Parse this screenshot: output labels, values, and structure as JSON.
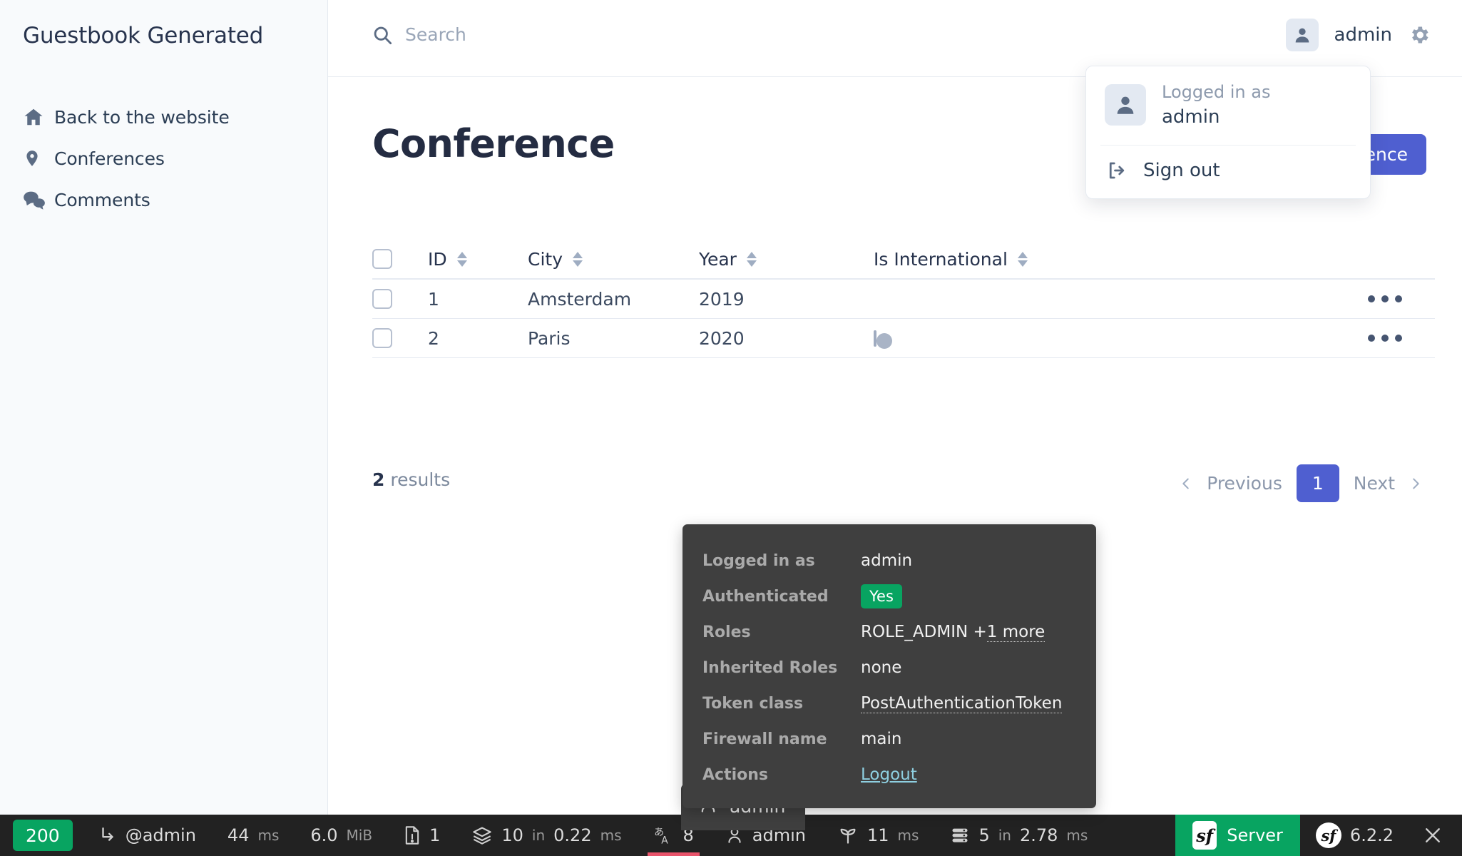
{
  "sidebar": {
    "brand": "Guestbook Generated",
    "items": [
      {
        "label": "Back to the website",
        "icon": "home-icon"
      },
      {
        "label": "Conferences",
        "icon": "map-pin-icon"
      },
      {
        "label": "Comments",
        "icon": "comments-icon"
      }
    ]
  },
  "header": {
    "search_placeholder": "Search",
    "search_value": "",
    "username": "admin",
    "gear_icon": "gear-icon"
  },
  "user_menu": {
    "logged_in_as_label": "Logged in as",
    "username": "admin",
    "sign_out_label": "Sign out"
  },
  "main": {
    "title": "Conference",
    "add_button_label": "Add Conference",
    "accent_color": "#4f5fd0"
  },
  "table": {
    "columns": [
      "ID",
      "City",
      "Year",
      "Is International"
    ],
    "rows": [
      {
        "id": "1",
        "city": "Amsterdam",
        "year": "2019",
        "is_international": true
      },
      {
        "id": "2",
        "city": "Paris",
        "year": "2020",
        "is_international": false
      }
    ],
    "actions_label": "..."
  },
  "footer": {
    "results_count": "2",
    "results_label": "results",
    "previous_label": "Previous",
    "current_page": "1",
    "next_label": "Next"
  },
  "debug_panel": {
    "rows": [
      {
        "key": "Logged in as",
        "value": "admin",
        "style": "plain"
      },
      {
        "key": "Authenticated",
        "value": "Yes",
        "style": "badge"
      },
      {
        "key": "Roles",
        "value": "ROLE_ADMIN + ",
        "extra": "1 more",
        "style": "dotted"
      },
      {
        "key": "Inherited Roles",
        "value": "none",
        "style": "plain"
      },
      {
        "key": "Token class",
        "value": "PostAuthenticationToken",
        "style": "dotted-full"
      },
      {
        "key": "Firewall name",
        "value": "main",
        "style": "plain"
      },
      {
        "key": "Actions",
        "value": "Logout",
        "style": "link"
      }
    ],
    "badge_color": "#08a461",
    "link_color": "#8ecfe0"
  },
  "toolbar": {
    "status_code": "200",
    "status_color": "#08a461",
    "route": "@admin",
    "time_value": "44",
    "time_unit": "ms",
    "memory_value": "6.0",
    "memory_unit": "MiB",
    "forms_count": "1",
    "cache_count": "10",
    "cache_in": "in",
    "cache_time": "0.22",
    "cache_unit": "ms",
    "translations_count": "8",
    "user_name": "admin",
    "twig_value": "11",
    "twig_unit": "ms",
    "db_count": "5",
    "db_in": "in",
    "db_time": "2.78",
    "db_unit": "ms",
    "server_label": "Server",
    "version": "6.2.2",
    "tooltip_user": "admin"
  }
}
